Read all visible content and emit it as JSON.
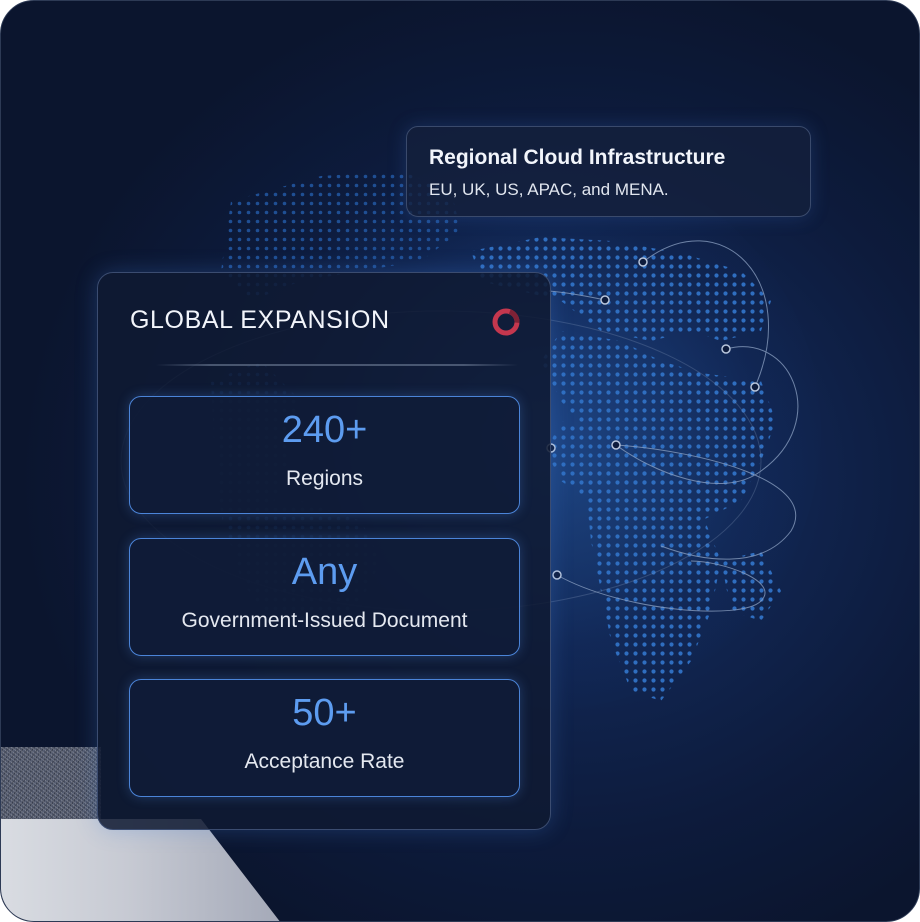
{
  "info_card": {
    "title": "Regional Cloud Infrastructure",
    "subtitle": "EU, UK, US, APAC, and MENA."
  },
  "main_card": {
    "title": "GLOBAL EXPANSION",
    "icon": "ring-icon",
    "stats": [
      {
        "value": "240+",
        "label": "Regions"
      },
      {
        "value": "Any",
        "label": "Government-Issued Document"
      },
      {
        "value": "50+",
        "label": "Acceptance Rate"
      }
    ]
  },
  "colors": {
    "background": "#0d1b3c",
    "accent": "#5d9cf0",
    "ring_icon": "#c4374e",
    "card_border": "#4b84d8",
    "map_dots": "#2f6ec0"
  }
}
